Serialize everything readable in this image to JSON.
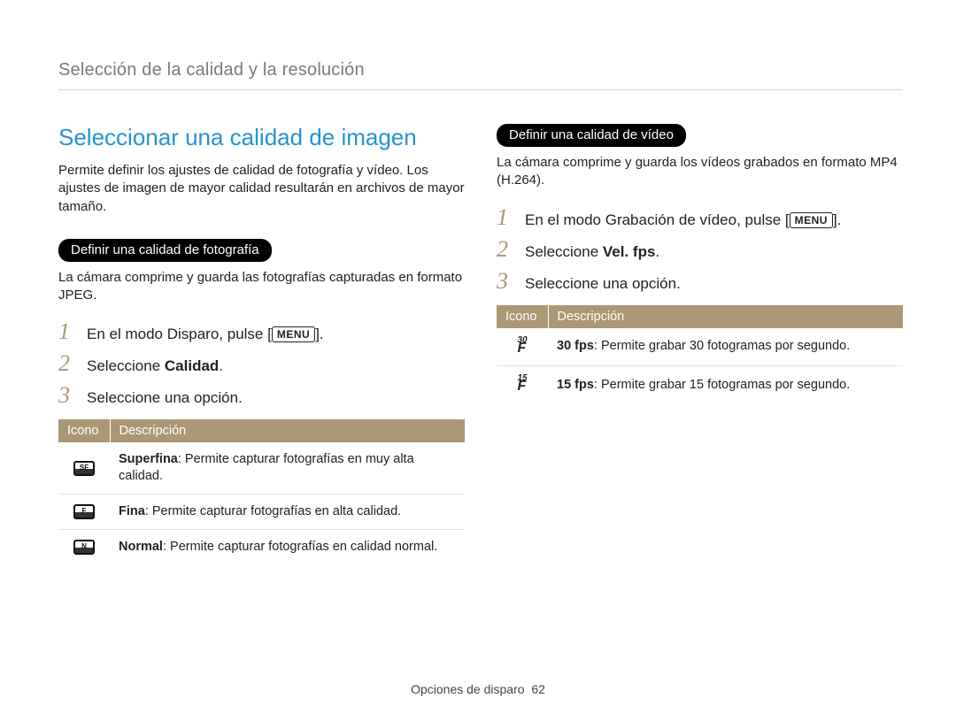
{
  "breadcrumb": "Selección de la calidad y la resolución",
  "left": {
    "heading": "Seleccionar una calidad de imagen",
    "intro": "Permite definir los ajustes de calidad de fotografía y vídeo. Los ajustes de imagen de mayor calidad resultarán en archivos de mayor tamaño.",
    "pill": "Definir una calidad de fotografía",
    "subtext": "La cámara comprime y guarda las fotografías capturadas en formato JPEG.",
    "step1_pre": "En el modo Disparo, pulse [",
    "step1_post": "].",
    "step2_pre": "Seleccione ",
    "step2_bold": "Calidad",
    "step2_post": ".",
    "step3": "Seleccione una opción.",
    "menu_label": "MENU",
    "table": {
      "h_icon": "Icono",
      "h_desc": "Descripción",
      "rows": [
        {
          "icon": "sf",
          "bold": "Superfina",
          "rest": ": Permite capturar fotografías en muy alta calidad."
        },
        {
          "icon": "f",
          "bold": "Fina",
          "rest": ": Permite capturar fotografías en alta calidad."
        },
        {
          "icon": "n",
          "bold": "Normal",
          "rest": ": Permite capturar fotografías en calidad normal."
        }
      ]
    }
  },
  "right": {
    "pill": "Definir una calidad de vídeo",
    "subtext": "La cámara comprime y guarda los vídeos grabados en formato MP4 (H.264).",
    "step1_pre": "En el modo Grabación de vídeo, pulse [",
    "step1_post": "].",
    "step2_pre": "Seleccione ",
    "step2_bold": "Vel. fps",
    "step2_post": ".",
    "step3": "Seleccione una opción.",
    "menu_label": "MENU",
    "table": {
      "h_icon": "Icono",
      "h_desc": "Descripción",
      "rows": [
        {
          "fps": "30",
          "bold": "30 fps",
          "rest": ": Permite grabar 30 fotogramas por segundo."
        },
        {
          "fps": "15",
          "bold": "15 fps",
          "rest": ": Permite grabar 15 fotogramas por segundo."
        }
      ]
    }
  },
  "footer_section": "Opciones de disparo",
  "footer_page": "62"
}
